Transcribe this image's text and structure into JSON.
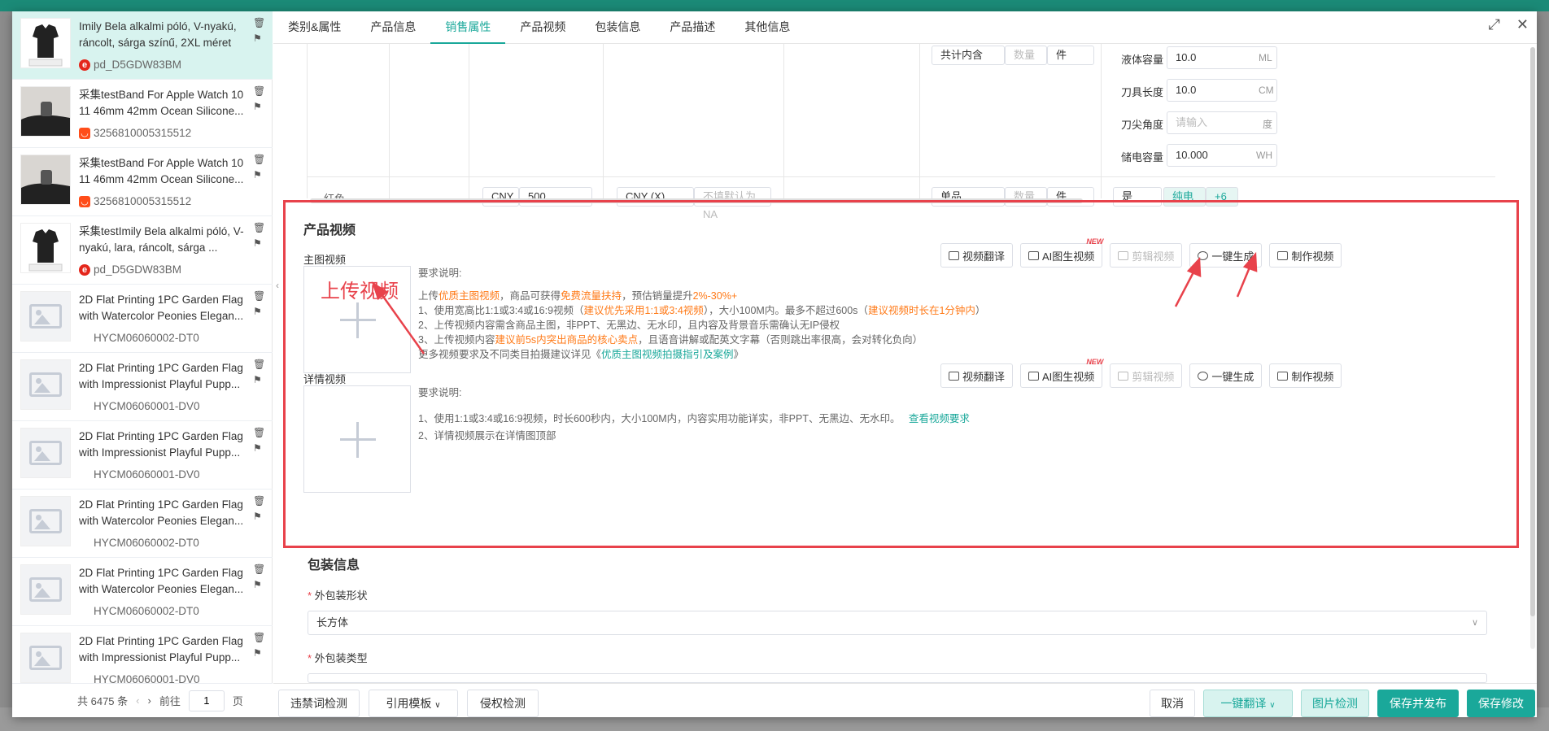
{
  "sidebar": {
    "items": [
      {
        "title": "Imily Bela alkalmi póló, V-nyakú, ráncolt, sárga színű, 2XL méret",
        "sub": "pd_D5GDW83BM",
        "platform": "e",
        "thumb": "shirt"
      },
      {
        "title": "采集testBand For Apple Watch 10 11 46mm 42mm Ocean Silicone...",
        "sub": "3256810005315512",
        "platform": "ali",
        "thumb": "watch"
      },
      {
        "title": "采集testBand For Apple Watch 10 11 46mm 42mm Ocean Silicone...",
        "sub": "3256810005315512",
        "platform": "ali",
        "thumb": "watch2"
      },
      {
        "title": "采集testImily Bela alkalmi póló, V-nyakú, lara, ráncolt, sárga ...",
        "sub": "pd_D5GDW83BM",
        "platform": "e",
        "thumb": "shirt"
      },
      {
        "title": "2D Flat Printing 1PC Garden Flag with Watercolor Peonies Elegan...",
        "sub": "HYCM06060002-DT0",
        "platform": "",
        "thumb": "ph"
      },
      {
        "title": "2D Flat Printing 1PC Garden Flag with Impressionist Playful Pupp...",
        "sub": "HYCM06060001-DV0",
        "platform": "",
        "thumb": "ph"
      },
      {
        "title": "2D Flat Printing 1PC Garden Flag with Impressionist Playful Pupp...",
        "sub": "HYCM06060001-DV0",
        "platform": "",
        "thumb": "ph"
      },
      {
        "title": "2D Flat Printing 1PC Garden Flag with Watercolor Peonies Elegan...",
        "sub": "HYCM06060002-DT0",
        "platform": "",
        "thumb": "ph"
      },
      {
        "title": "2D Flat Printing 1PC Garden Flag with Watercolor Peonies Elegan...",
        "sub": "HYCM06060002-DT0",
        "platform": "",
        "thumb": "ph"
      },
      {
        "title": "2D Flat Printing 1PC Garden Flag with Impressionist Playful Pupp...",
        "sub": "HYCM06060001-DV0",
        "platform": "",
        "thumb": "ph"
      }
    ],
    "footer": {
      "total": "共 6475 条",
      "goto": "前往",
      "page": "1",
      "page_suffix": "页"
    }
  },
  "tabs": [
    "类别&属性",
    "产品信息",
    "销售属性",
    "产品视频",
    "包装信息",
    "产品描述",
    "其他信息"
  ],
  "active_tab": "销售属性",
  "table": {
    "props": [
      {
        "label": "液体容量",
        "value": "10.0",
        "unit": "ML"
      },
      {
        "label": "刀具长度",
        "value": "10.0",
        "unit": "CM"
      },
      {
        "label": "刀尖角度",
        "value": "",
        "placeholder": "请输入",
        "unit": "度"
      },
      {
        "label": "储电容量",
        "value": "10.000",
        "unit": "WH"
      }
    ],
    "row_color": "红色",
    "currency": "CNY",
    "price": "500",
    "currency_x": "CNY (X)",
    "na_placeholder": "不填默认为NA",
    "pack_label": "共计内含",
    "qty_placeholder": "数量",
    "unit_piece": "件",
    "single_item": "单品",
    "yes": "是",
    "tag1": "纯电",
    "tag2": "+6"
  },
  "video_section": {
    "title": "产品视频",
    "main_label": "主图视频",
    "detail_label": "详情视频",
    "upload_text": "上传视频",
    "buttons": [
      "视频翻译",
      "AI图生视频",
      "剪辑视频",
      "一键生成",
      "制作视频"
    ],
    "new_badge": "NEW",
    "req_title": "要求说明:",
    "main_req": {
      "line0_a": "上传",
      "line0_b": "优质主图视频",
      "line0_c": "，商品可获得",
      "line0_d": "免费流量扶持",
      "line0_e": "，预估销量提升",
      "line0_f": "2%-30%+",
      "line1_a": "1、使用宽高比1:1或3:4或16:9视频（",
      "line1_b": "建议优先采用1:1或3:4视频",
      "line1_c": "），大小100M内。最多不超过600s（",
      "line1_d": "建议视频时长在1分钟内",
      "line1_e": "）",
      "line2": "2、上传视频内容需含商品主图，非PPT、无黑边、无水印，且内容及背景音乐需确认无IP侵权",
      "line3_a": "3、上传视频内容",
      "line3_b": "建议前5s内突出商品的核心卖点",
      "line3_c": "，且语音讲解或配英文字幕（否则跳出率很高，会对转化负向）",
      "line4_a": "更多视频要求及不同类目拍摄建议详见《",
      "line4_b": "优质主图视频拍摄指引及案例",
      "line4_c": "》"
    },
    "detail_req": {
      "line1": "1、使用1:1或3:4或16:9视频，时长600秒内，大小100M内，内容实用功能详实，非PPT、无黑边、无水印。",
      "link": "查看视频要求",
      "line2": "2、详情视频展示在详情图顶部"
    }
  },
  "packaging": {
    "title": "包装信息",
    "shape_label": "外包装形状",
    "shape_value": "长方体",
    "type_label": "外包装类型"
  },
  "bottom": {
    "check_words": "违禁词检测",
    "template": "引用模板",
    "infringe": "侵权检测",
    "cancel": "取消",
    "translate": "一键翻译",
    "img_check": "图片检测",
    "save_publish": "保存并发布",
    "save": "保存修改"
  },
  "colors": {
    "accent": "#1aa89a",
    "highlight": "#e8424b",
    "orange": "#ff7a18"
  }
}
